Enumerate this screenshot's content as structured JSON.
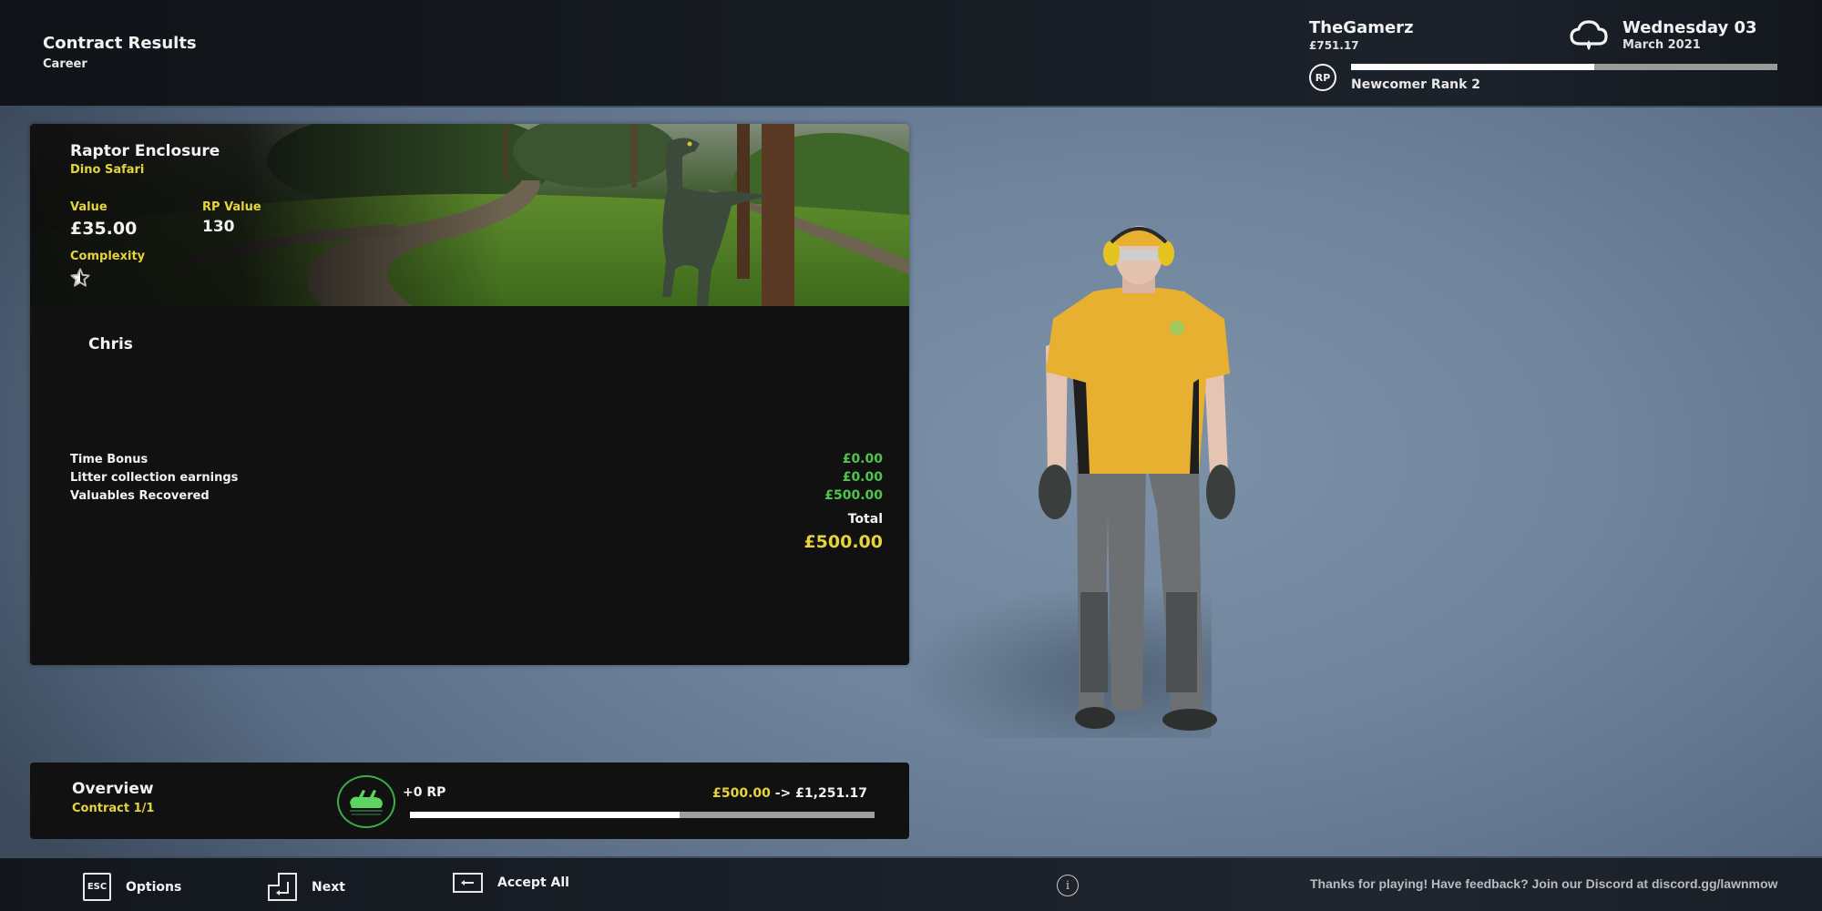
{
  "header": {
    "title": "Contract Results",
    "subtitle": "Career",
    "player_name": "TheGamerz",
    "player_money": "£751.17",
    "weather_icon": "cloud-rain-icon",
    "date_day": "Wednesday 03",
    "date_month": "March 2021",
    "rank_badge": "RP",
    "rank_label": "Newcomer Rank 2",
    "rank_progress": 0.57
  },
  "contract": {
    "name": "Raptor Enclosure",
    "location": "Dino Safari",
    "value_label": "Value",
    "value": "£35.00",
    "rp_label": "RP Value",
    "rp_value": "130",
    "complexity_label": "Complexity",
    "complexity_rating": 0.5,
    "complexity_max": 5,
    "employee": "Chris",
    "earnings": [
      {
        "label": "Time Bonus",
        "value": "£0.00"
      },
      {
        "label": "Litter collection earnings",
        "value": "£0.00"
      },
      {
        "label": "Valuables Recovered",
        "value": "£500.00"
      }
    ],
    "total_label": "Total",
    "total_value": "£500.00"
  },
  "overview": {
    "title": "Overview",
    "contract_count": "Contract 1/1",
    "badge_icon": "lawnmower-icon",
    "rp_gain": "+0 RP",
    "money_earned": "£500.00",
    "money_arrow": "->",
    "money_new_total": "£1,251.17",
    "money_progress": 0.58
  },
  "footer": {
    "actions": [
      {
        "key": "ESC",
        "label": "Options"
      },
      {
        "key": "enter-key-icon",
        "label": "Next"
      },
      {
        "key": "backspace-key-icon",
        "label": "Accept All"
      }
    ],
    "info_icon": "i",
    "feedback_text": "Thanks for playing! Have feedback? Join our Discord at discord.gg/lawnmow"
  },
  "colors": {
    "accent_yellow": "#e6d43a",
    "money_green": "#4fc44f",
    "badge_green": "#38b04a"
  }
}
